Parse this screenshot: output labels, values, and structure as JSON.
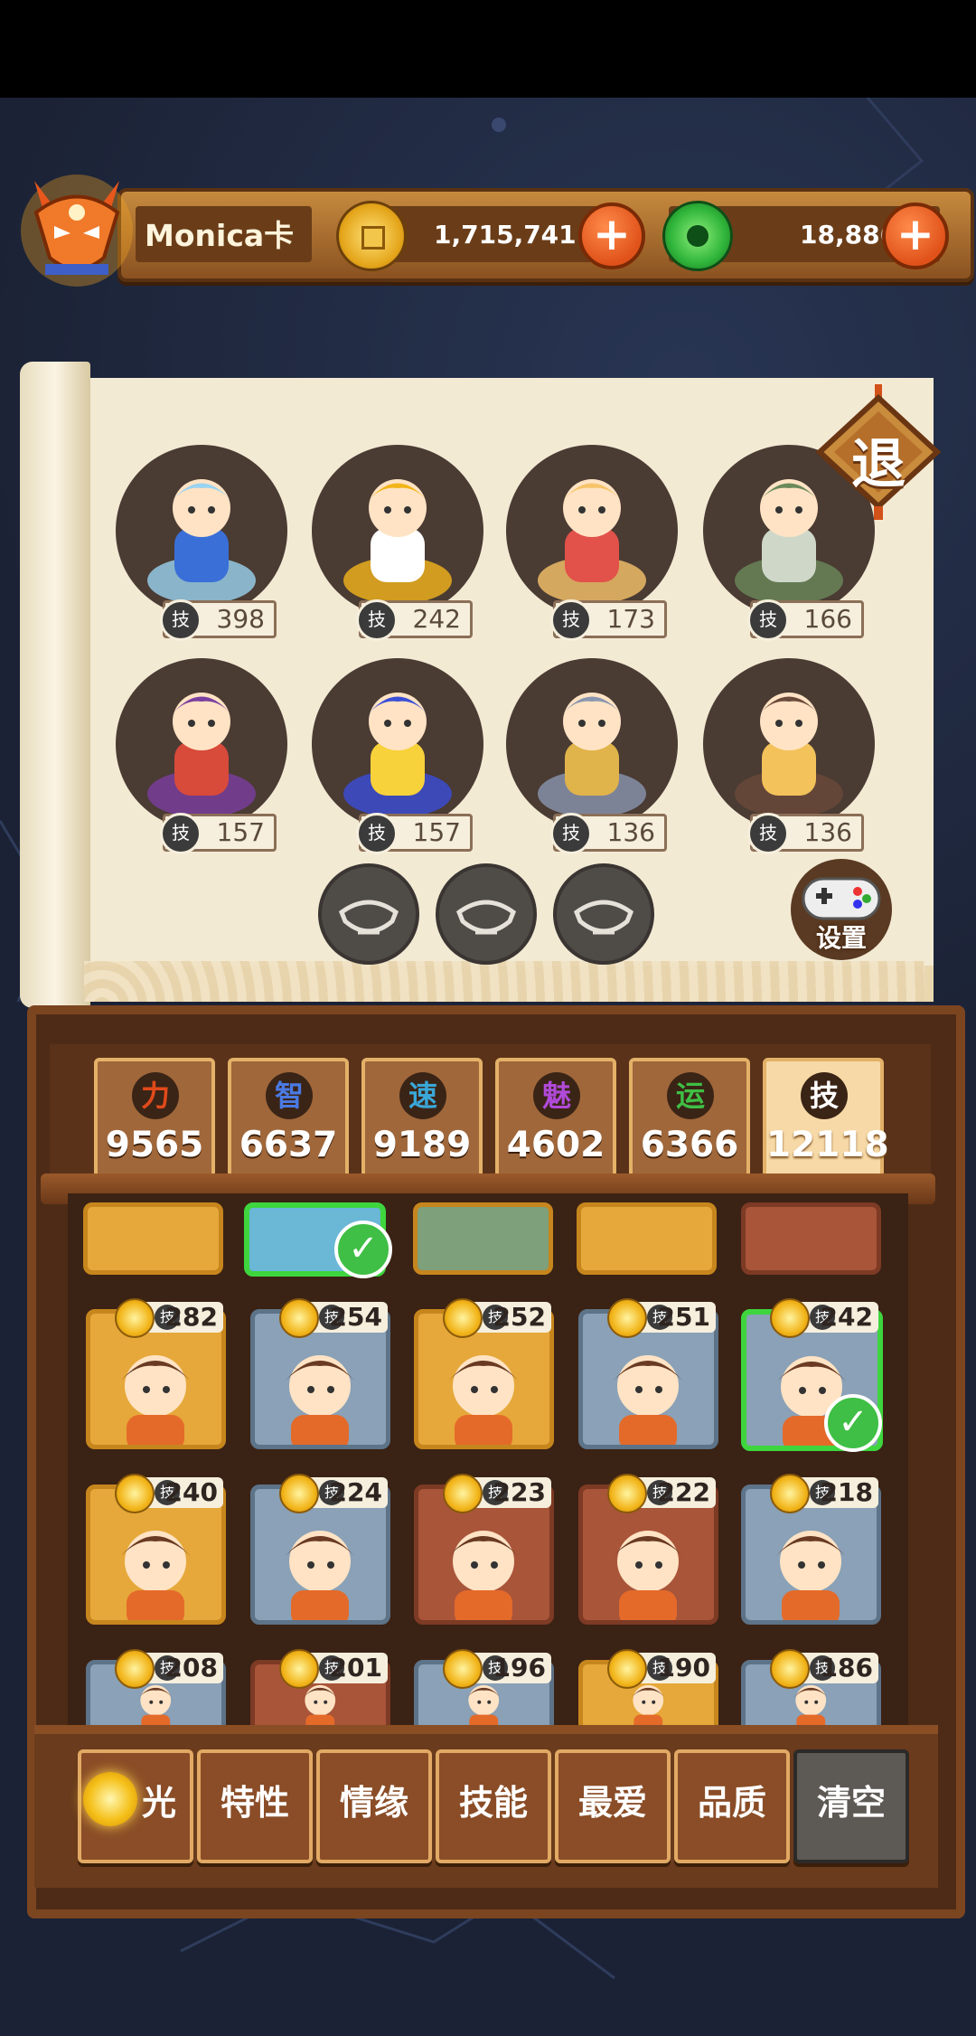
{
  "player": {
    "name": "Monica卡"
  },
  "currency": {
    "coins": "1,715,741",
    "gems": "18,886",
    "plus": "+"
  },
  "exit_label": "退",
  "gamepad_label": "设置",
  "team": [
    {
      "level": "398"
    },
    {
      "level": "242"
    },
    {
      "level": "173"
    },
    {
      "level": "166"
    },
    {
      "level": "157"
    },
    {
      "level": "157"
    },
    {
      "level": "136"
    },
    {
      "level": "136"
    }
  ],
  "skill_glyph": "技",
  "stats": [
    {
      "glyph": "力",
      "value": "9565",
      "color": "#e24a1a"
    },
    {
      "glyph": "智",
      "value": "6637",
      "color": "#4a7ae2"
    },
    {
      "glyph": "速",
      "value": "9189",
      "color": "#3aa7d8"
    },
    {
      "glyph": "魅",
      "value": "4602",
      "color": "#b04ad8"
    },
    {
      "glyph": "运",
      "value": "6366",
      "color": "#3fbf45"
    },
    {
      "glyph": "技",
      "value": "12118",
      "color": "#ffffff"
    }
  ],
  "cards": [
    {
      "level": "282",
      "tone": "gold"
    },
    {
      "level": "254",
      "tone": "blue"
    },
    {
      "level": "252",
      "tone": "gold"
    },
    {
      "level": "251",
      "tone": "blue"
    },
    {
      "level": "242",
      "tone": "blue",
      "selected": true
    },
    {
      "level": "240",
      "tone": "gold"
    },
    {
      "level": "224",
      "tone": "blue"
    },
    {
      "level": "223",
      "tone": "brown"
    },
    {
      "level": "222",
      "tone": "brown"
    },
    {
      "level": "218",
      "tone": "blue"
    },
    {
      "level": "208",
      "tone": "blue"
    },
    {
      "level": "201",
      "tone": "brown"
    },
    {
      "level": "196",
      "tone": "blue"
    },
    {
      "level": "190",
      "tone": "gold"
    },
    {
      "level": "186",
      "tone": "blue"
    }
  ],
  "filters": [
    {
      "label": "光"
    },
    {
      "label": "特性"
    },
    {
      "label": "情缘"
    },
    {
      "label": "技能"
    },
    {
      "label": "最爱"
    },
    {
      "label": "品质"
    },
    {
      "label": "清空"
    }
  ]
}
